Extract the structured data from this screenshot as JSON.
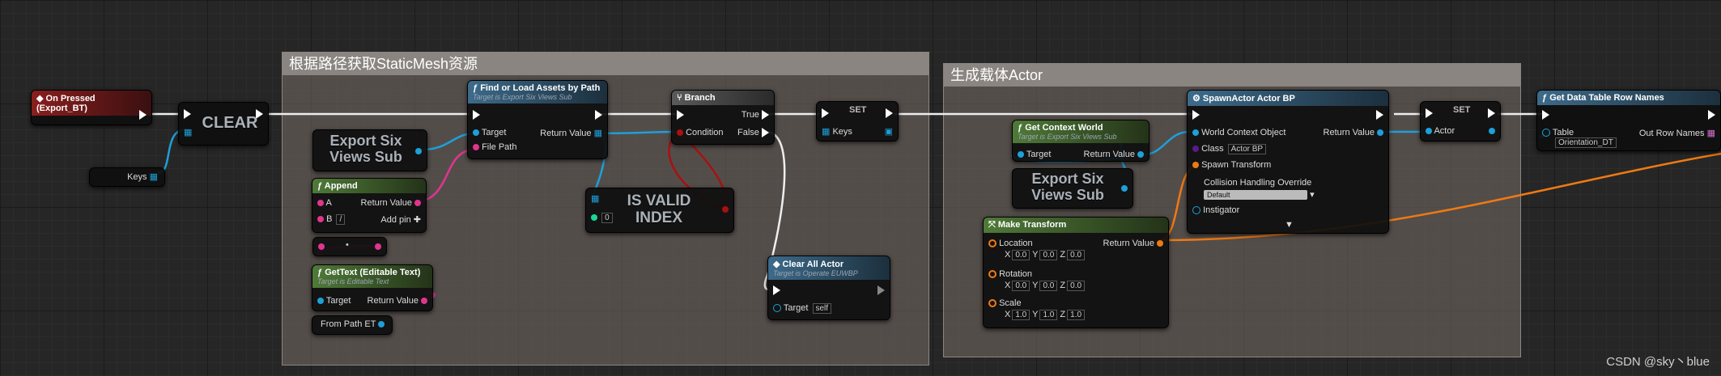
{
  "comments": {
    "left_title": "根据路径获取StaticMesh资源",
    "right_title": "生成载体Actor"
  },
  "nodes": {
    "event": {
      "title": "On Pressed (Export_BT)"
    },
    "clear": {
      "label": "CLEAR"
    },
    "keys_var": {
      "label": "Keys"
    },
    "export_var1": {
      "line1": "Export Six",
      "line2": "Views Sub"
    },
    "find_load": {
      "title": "Find or Load Assets by Path",
      "sub": "Target is Export Six Views Sub",
      "target": "Target",
      "file_path": "File Path",
      "return_value": "Return Value"
    },
    "append": {
      "title": "Append",
      "a": "A",
      "b": "B",
      "b_value": "/",
      "return_value": "Return Value",
      "add_pin": "Add pin"
    },
    "dot": {
      "label": "•"
    },
    "gettext": {
      "title": "GetText (Editable Text)",
      "sub": "Target is Editable Text",
      "target": "Target",
      "return_value": "Return Value"
    },
    "from_path": {
      "label": "From Path ET"
    },
    "branch": {
      "title": "Branch",
      "true": "True",
      "false": "False",
      "condition": "Condition"
    },
    "set1": {
      "title": "SET",
      "keys": "Keys"
    },
    "is_valid": {
      "line1": "IS VALID",
      "line2": "INDEX",
      "index_value": "0"
    },
    "clear_all": {
      "title": "Clear All Actor",
      "sub": "Target is Operate EUWBP",
      "target": "Target",
      "target_value": "self"
    },
    "get_context": {
      "title": "Get Context World",
      "sub": "Target is Export Six Views Sub",
      "target": "Target",
      "return_value": "Return Value"
    },
    "export_var2": {
      "line1": "Export Six",
      "line2": "Views Sub"
    },
    "spawn": {
      "title": "SpawnActor Actor BP",
      "world_context": "World Context Object",
      "class": "Class",
      "class_value": "Actor BP",
      "spawn_transform": "Spawn Transform",
      "collision": "Collision Handling Override",
      "collision_value": "Default",
      "instigator": "Instigator",
      "return_value": "Return Value"
    },
    "make_transform": {
      "title": "Make Transform",
      "location": "Location",
      "rotation": "Rotation",
      "scale": "Scale",
      "return_value": "Return Value",
      "loc": [
        "0.0",
        "0.0",
        "0.0"
      ],
      "rot": [
        "0.0",
        "0.0",
        "0.0"
      ],
      "scl": [
        "1.0",
        "1.0",
        "1.0"
      ],
      "axes": [
        "X",
        "Y",
        "Z"
      ]
    },
    "set2": {
      "title": "SET",
      "actor": "Actor"
    },
    "get_dt": {
      "title": "Get Data Table Row Names",
      "table": "Table",
      "table_value": "Orientation_DT",
      "out_row_names": "Out Row Names"
    }
  },
  "watermark": "CSDN @sky丶blue",
  "colors": {
    "exec": "#ffffff",
    "object": "#1ea0d8",
    "string": "#e0358f",
    "bool": "#a91010",
    "transform": "#ef7a13",
    "array_key": "#1ea0d8"
  }
}
